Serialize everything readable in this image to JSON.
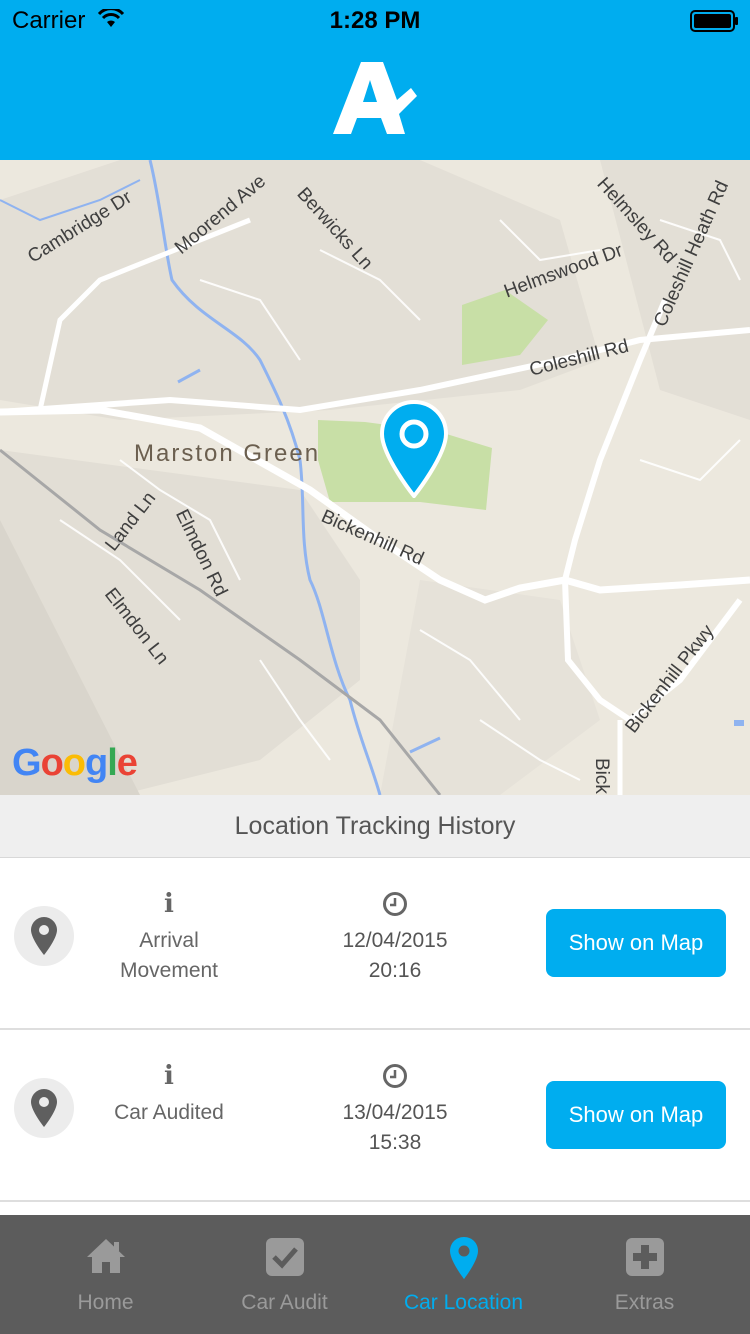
{
  "status_bar": {
    "carrier": "Carrier",
    "time": "1:28 PM"
  },
  "header": {
    "logo_icon": "brand-a-logo",
    "accent_color": "#00adef"
  },
  "map": {
    "labels": {
      "cambridge": "Cambridge Dr",
      "moorend": "Moorend Ave",
      "berwicks": "Berwicks Ln",
      "helmsley": "Helmsley Rd",
      "coleshill_heath": "Coleshill Heath Rd",
      "helmswood": "Helmswood Dr",
      "coleshill": "Coleshill Rd",
      "marston": "Marston Green",
      "bickenhill": "Bickenhill Rd",
      "land": "Land Ln",
      "elmdon_rd": "Elmdon Rd",
      "elmdon_ln": "Elmdon Ln",
      "bickenhill_pkwy": "Bickenhill Pkwy",
      "bick": "Bick"
    },
    "attribution": "Google",
    "pin_icon": "map-pin-icon"
  },
  "history": {
    "title": "Location Tracking History",
    "rows": [
      {
        "event_line1": "Arrival",
        "event_line2": "Movement",
        "date": "12/04/2015",
        "time": "20:16",
        "button": "Show on Map"
      },
      {
        "event_line1": "Car Audited",
        "event_line2": "",
        "date": "13/04/2015",
        "time": "15:38",
        "button": "Show on Map"
      }
    ]
  },
  "tabbar": {
    "tabs": [
      {
        "label": "Home",
        "icon": "home-icon"
      },
      {
        "label": "Car Audit",
        "icon": "checkbox-icon"
      },
      {
        "label": "Car Location",
        "icon": "location-pin-icon",
        "active": true
      },
      {
        "label": "Extras",
        "icon": "plus-square-icon"
      }
    ],
    "active_color": "#00adef",
    "inactive_color": "#9a9a9a"
  }
}
